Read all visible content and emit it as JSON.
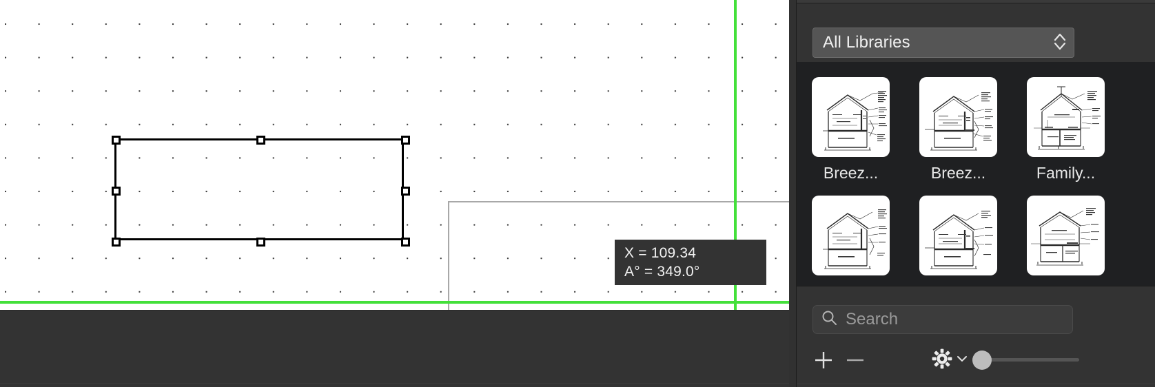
{
  "canvas": {
    "tooltip": {
      "line1": "X = 109.34",
      "line2": "A° = 349.0°"
    },
    "guide_color": "#43e03a",
    "selection_stroke": "#000000",
    "secondary_rect_stroke": "#a8a8a8"
  },
  "panel": {
    "library_selector": {
      "value": "All Libraries",
      "icon": "stepper-updown-icon"
    },
    "items": [
      {
        "label": "Breez...",
        "icon": "house-section-drawing"
      },
      {
        "label": "Breez...",
        "icon": "house-section-drawing"
      },
      {
        "label": "Family...",
        "icon": "house-section-drawing"
      },
      {
        "label": "",
        "icon": "house-section-drawing"
      },
      {
        "label": "",
        "icon": "house-section-drawing"
      },
      {
        "label": "",
        "icon": "house-section-drawing"
      }
    ],
    "search": {
      "placeholder": "Search",
      "value": "",
      "icon": "search-icon"
    },
    "tools": {
      "add_label": "+",
      "remove_label": "−",
      "settings_icon": "gear-icon",
      "settings_chevron": "chevron-down-icon",
      "zoom_slider_value": 0
    }
  }
}
